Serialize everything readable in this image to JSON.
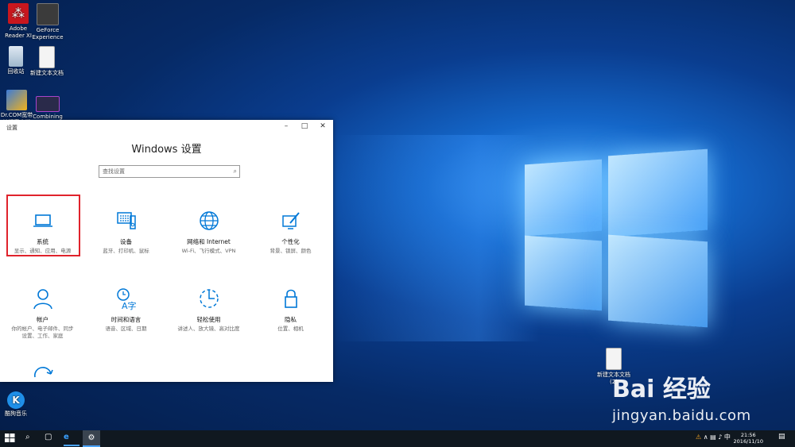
{
  "desktop": {
    "icons": [
      {
        "label": "Adobe\nReader XI"
      },
      {
        "label": "GeForce\nExperience"
      },
      {
        "label": "回收站"
      },
      {
        "label": "新建文本文档"
      },
      {
        "label": "Dr.COM宽带\n认证客户端"
      },
      {
        "label": "Combining\nObjects"
      },
      {
        "label": "酷狗音乐"
      },
      {
        "label": "新建文本文档\n(2)"
      }
    ]
  },
  "window": {
    "title": "设置",
    "heading": "Windows 设置",
    "search_placeholder": "查找设置",
    "tiles": [
      {
        "name": "系统",
        "desc": "显示、通知、应用、电源"
      },
      {
        "name": "设备",
        "desc": "蓝牙、打印机、鼠标"
      },
      {
        "name": "网络和 Internet",
        "desc": "Wi-Fi、飞行模式、VPN"
      },
      {
        "name": "个性化",
        "desc": "背景、锁屏、颜色"
      },
      {
        "name": "帐户",
        "desc": "你的帐户、电子邮件、同步设置、工作、家庭"
      },
      {
        "name": "时间和语言",
        "desc": "语音、区域、日期"
      },
      {
        "name": "轻松使用",
        "desc": "讲述人、放大镜、高对比度"
      },
      {
        "name": "隐私",
        "desc": "位置、相机"
      }
    ]
  },
  "taskbar": {
    "time": "21:56",
    "date": "2016/11/10"
  },
  "watermark": {
    "brand": "Bai 经验",
    "url": "jingyan.baidu.com"
  },
  "colors": {
    "accent": "#0078d7",
    "highlight": "#e0232c"
  }
}
